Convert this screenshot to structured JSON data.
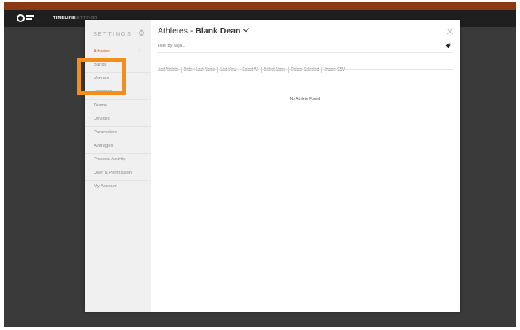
{
  "topbar": {
    "left_text": "",
    "right_text": ""
  },
  "nav": {
    "timeline_label": "TIMELINE",
    "settings_label": "SETTINGS"
  },
  "sidebar": {
    "title": "SETTINGS",
    "items": [
      {
        "label": "Athletes",
        "active": true
      },
      {
        "label": "Bands"
      },
      {
        "label": "Venues"
      },
      {
        "label": "Positions"
      },
      {
        "label": "Teams"
      },
      {
        "label": "Devices"
      },
      {
        "label": "Parameters"
      },
      {
        "label": "Averages"
      },
      {
        "label": "Process Activity"
      },
      {
        "label": "User & Permission"
      },
      {
        "label": "My Account"
      }
    ]
  },
  "main": {
    "title_prefix": "Athletes - ",
    "title_name": "Blank Dean",
    "filter_placeholder": "Filter By Tags...",
    "toolbar": [
      "Add Athlete",
      "Order: Last Name",
      "List View",
      "Select All",
      "Select None",
      "Delete Selected",
      "Import CSV"
    ],
    "empty_message": "No Athlete Found"
  },
  "colors": {
    "accent": "#e4532a",
    "highlight": "#f18e1c",
    "topbar": "#8a3a12"
  }
}
